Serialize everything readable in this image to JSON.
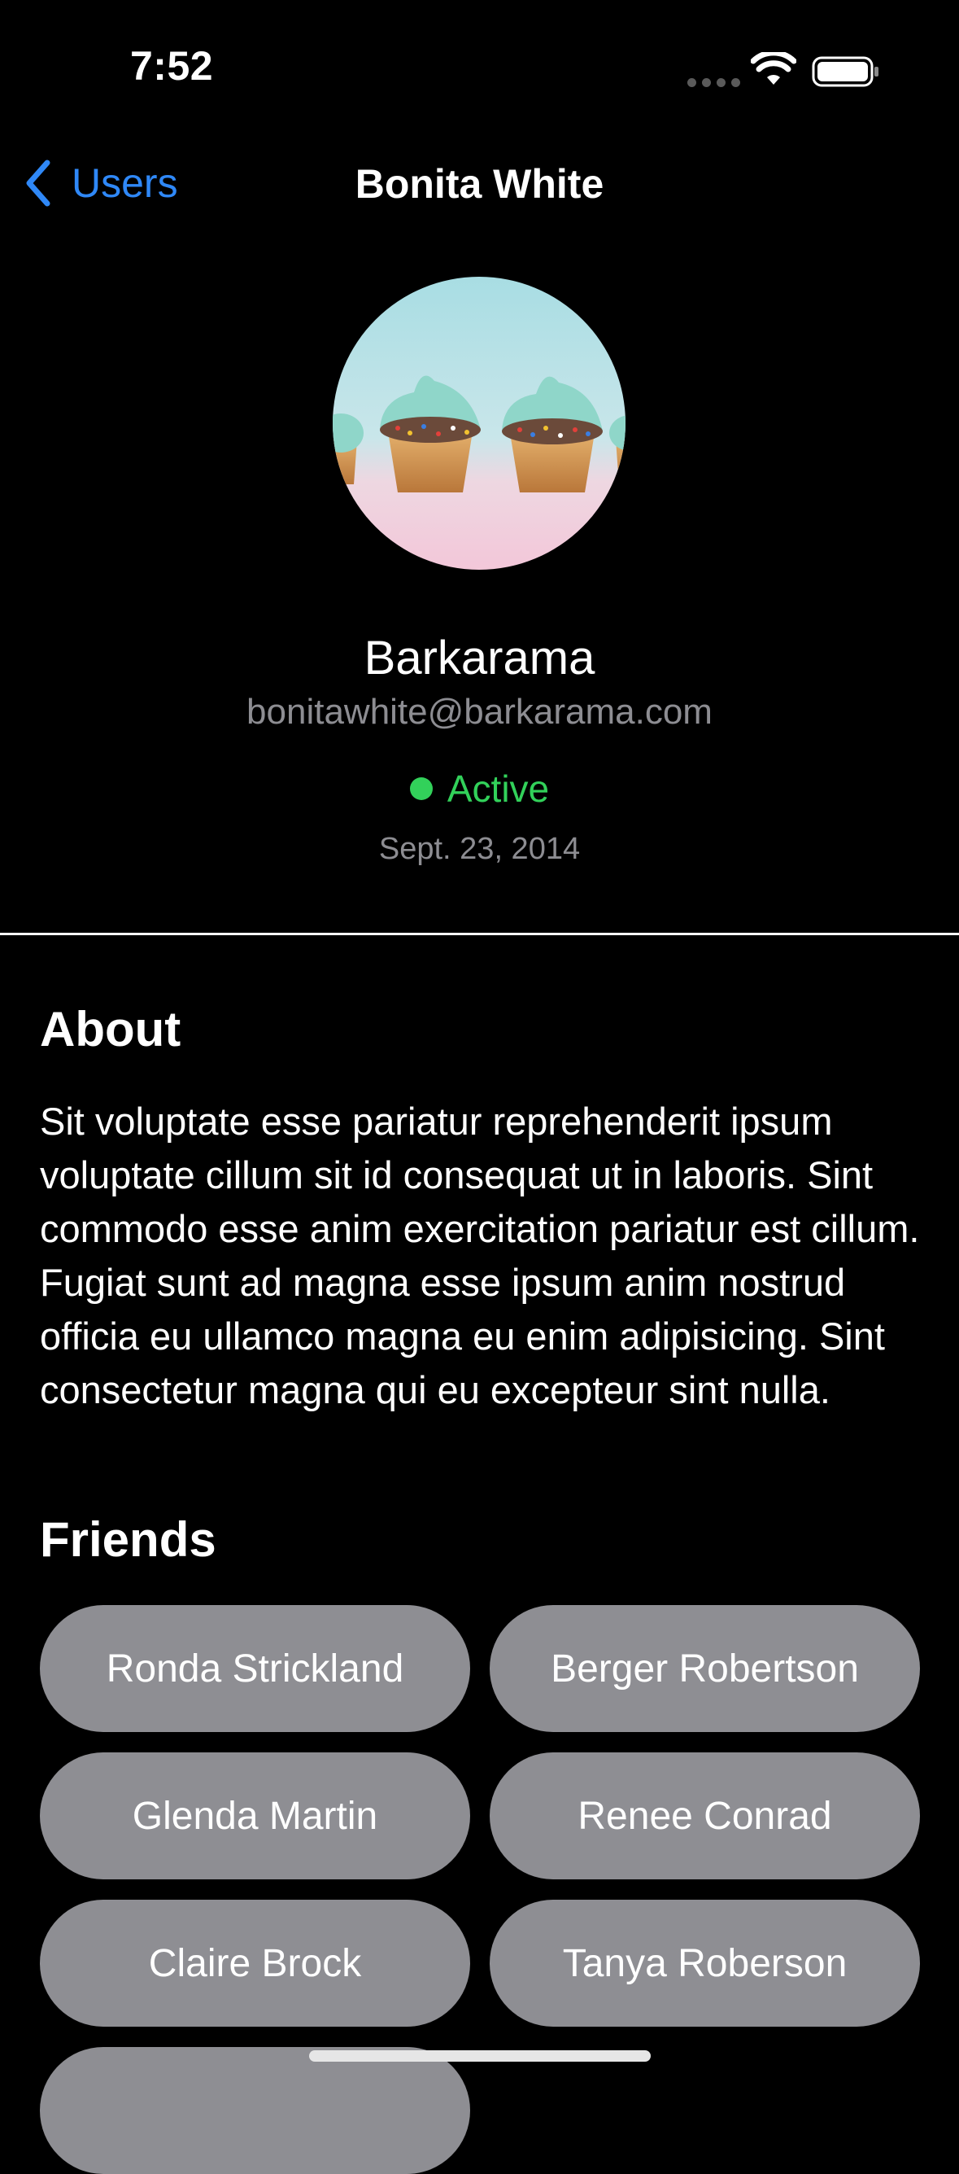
{
  "status_bar": {
    "time": "7:52",
    "icons": [
      "cellular-signal-icon",
      "wifi-icon",
      "battery-icon"
    ]
  },
  "nav": {
    "back_label": "Users",
    "title": "Bonita White",
    "back_icon": "chevron-left-icon"
  },
  "profile": {
    "avatar": "cupcakes-photo",
    "company": "Barkarama",
    "email": "bonitawhite@barkarama.com",
    "status": "Active",
    "registered": "Sept. 23, 2014"
  },
  "about": {
    "heading": "About",
    "text": "Sit voluptate esse pariatur reprehenderit ipsum voluptate cillum sit id consequat ut in laboris. Sint commodo esse anim exercitation pariatur est cillum. Fugiat sunt ad magna esse ipsum anim nostrud officia eu ullamco magna eu enim adipisicing. Sint consectetur magna qui eu excepteur sint nulla."
  },
  "friends": {
    "heading": "Friends",
    "items": [
      "Ronda Strickland",
      "Berger Robertson",
      "Glenda Martin",
      "Renee Conrad",
      "Claire Brock",
      "Tanya Roberson",
      ""
    ]
  },
  "colors": {
    "background": "#000000",
    "accent": "#2f88f7",
    "active": "#32d15a",
    "secondary_text": "#8d8d92",
    "pill": "#8e8e93"
  }
}
